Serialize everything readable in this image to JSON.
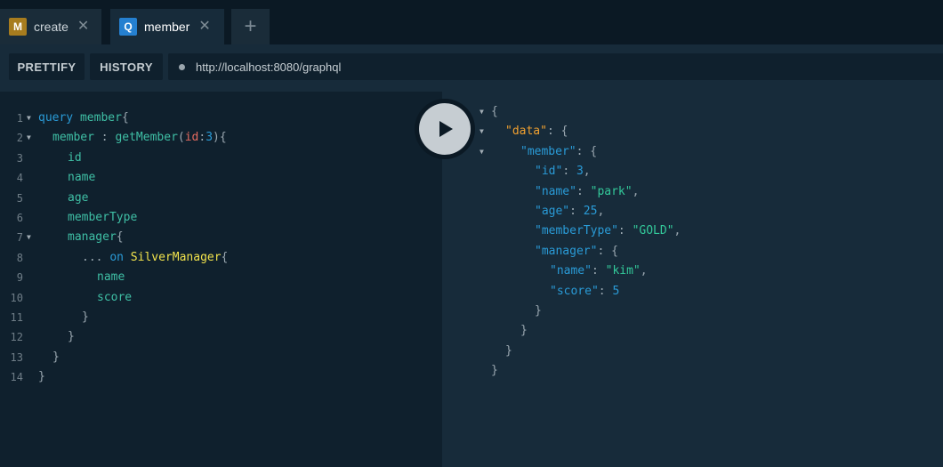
{
  "tabs": [
    {
      "badge": "M",
      "badge_color": "#a77c1e",
      "title": "create",
      "close": "✕",
      "active": false
    },
    {
      "badge": "Q",
      "badge_color": "#2580d0",
      "title": "member",
      "close": "✕",
      "active": true
    }
  ],
  "add_tab": "+",
  "toolbar": {
    "prettify_label": "PRETTIFY",
    "history_label": "HISTORY",
    "endpoint_url": "http://localhost:8080/graphql"
  },
  "query": {
    "line_numbers": [
      "1",
      "2",
      "3",
      "4",
      "5",
      "6",
      "7",
      "8",
      "9",
      "10",
      "11",
      "12",
      "13",
      "14"
    ],
    "l1": {
      "kw": "query",
      "name": "member",
      "brace": "{"
    },
    "l2": {
      "alias": "member",
      "colon": " : ",
      "fn": "getMember",
      "open": "(",
      "arg": "id",
      "sep": ":",
      "val": "3",
      "close": "){"
    },
    "l3": "id",
    "l4": "name",
    "l5": "age",
    "l6": "memberType",
    "l7": {
      "field": "manager",
      "brace": "{"
    },
    "l8": {
      "spread": "...",
      "on": "on",
      "type": "SilverManager",
      "brace": "{"
    },
    "l9": "name",
    "l10": "score",
    "l11": "}",
    "l12": "}",
    "l13": "}",
    "l14": "}"
  },
  "result": {
    "open": "{",
    "data_key": "\"data\"",
    "member_key": "\"member\"",
    "id_key": "\"id\"",
    "id_val": "3",
    "name_key": "\"name\"",
    "name_val": "\"park\"",
    "age_key": "\"age\"",
    "age_val": "25",
    "type_key": "\"memberType\"",
    "type_val": "\"GOLD\"",
    "manager_key": "\"manager\"",
    "mname_key": "\"name\"",
    "mname_val": "\"kim\"",
    "score_key": "\"score\"",
    "score_val": "5",
    "colon_brace": ": {",
    "colon": ": ",
    "comma": ",",
    "close": "}"
  }
}
